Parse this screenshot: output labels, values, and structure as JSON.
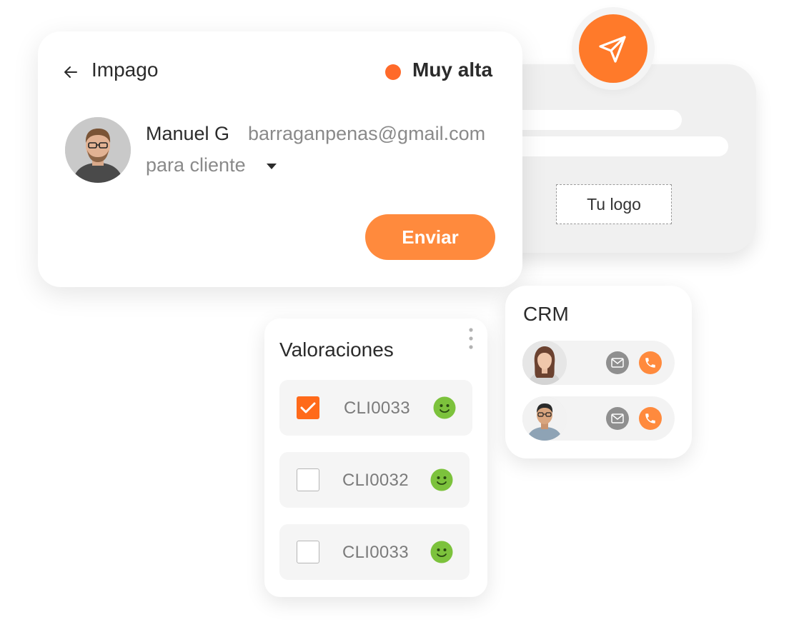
{
  "ticket": {
    "title": "Impago",
    "priority_label": "Muy alta",
    "priority_color": "#ff6a2a",
    "contact_name": "Manuel G",
    "contact_email": "barraganpenas@gmail.com",
    "recipient": "para cliente",
    "send_label": "Enviar"
  },
  "preview": {
    "logo_label": "Tu logo"
  },
  "crm": {
    "title": "CRM",
    "contacts": [
      {
        "avatar": "woman-avatar",
        "actions": [
          "mail-icon",
          "phone-icon"
        ]
      },
      {
        "avatar": "man-avatar",
        "actions": [
          "mail-icon",
          "phone-icon"
        ]
      }
    ]
  },
  "ratings": {
    "title": "Valoraciones",
    "rows": [
      {
        "code": "CLI0033",
        "checked": true,
        "mood": "happy"
      },
      {
        "code": "CLI0032",
        "checked": false,
        "mood": "happy"
      },
      {
        "code": "CLI0033",
        "checked": false,
        "mood": "happy"
      }
    ]
  },
  "colors": {
    "accent": "#ff8a3d",
    "accent_dark": "#ff6a1a",
    "smiley": "#7cc23c",
    "card_grey": "#f0f0f0"
  }
}
